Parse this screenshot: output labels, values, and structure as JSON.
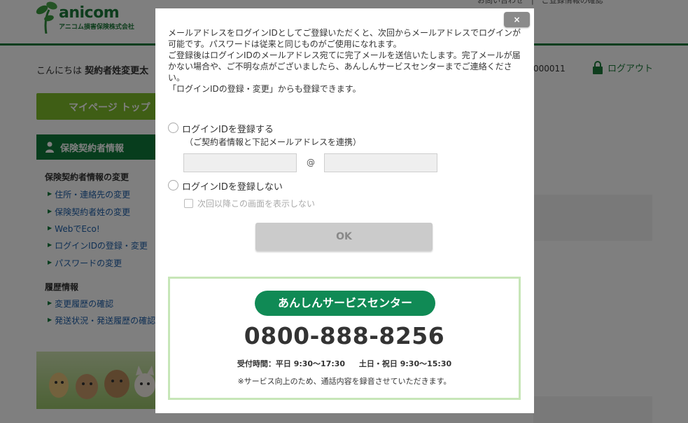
{
  "header": {
    "logo_word": "anicom",
    "logo_sub": "アニコム損害保険株式会社",
    "top_links": "お問い合わせ　|　ご登録情報の確認"
  },
  "user_bar": {
    "greeting_prefix": "こんにちは",
    "user_name": "契約者姓変更太",
    "contract_number": "000011",
    "logout_label": "ログアウト"
  },
  "sidebar": {
    "mypage_label": "マイページ トップ",
    "section_title": "保険契約者情報",
    "groups": [
      {
        "title": "保険契約者情報の変更",
        "links": [
          "住所・連絡先の変更",
          "保険契約者姓の変更",
          "WebでEco!",
          "ログインIDの登録・変更",
          "パスワードの変更"
        ]
      },
      {
        "title": "履歴情報",
        "links": [
          "変更履歴の確認",
          "発送状況・発送履歴の確認"
        ]
      }
    ]
  },
  "modal": {
    "close_label": "×",
    "intro": [
      "メールアドレスをログインIDとしてご登録いただくと、次回からメールアドレスでログインが可能です。パスワードは従来と同じものがご使用になれます。",
      "ご登録後はログインIDのメールアドレス宛てに完了メールを送信いたします。完了メールが届かない場合や、ご不明な点がございましたら、あんしんサービスセンターまでご連絡ください。",
      "「ログインIDの登録・変更」からも登録できます。"
    ],
    "option_register": "ログインIDを登録する",
    "option_register_note": "（ご契約者情報と下記メールアドレスを連携）",
    "email_local_placeholder": "",
    "email_at": "@",
    "email_domain_placeholder": "",
    "option_no_register": "ログインIDを登録しない",
    "skip_label": "次回以降この画面を表示しない",
    "ok_label": "OK"
  },
  "service_center": {
    "title": "あんしんサービスセンター",
    "phone": "0800-888-8256",
    "hours_weekday": "受付時間：平日 9:30〜17:30",
    "hours_weekend": "土日・祝日 9:30〜15:30",
    "notice": "※サービス向上のため、通話内容を録音させていただきます。"
  },
  "colors": {
    "brand_green": "#0f7a3a",
    "service_green": "#108a55",
    "box_border": "#c7e6b8",
    "mypage_green": "#7fbd2a"
  }
}
